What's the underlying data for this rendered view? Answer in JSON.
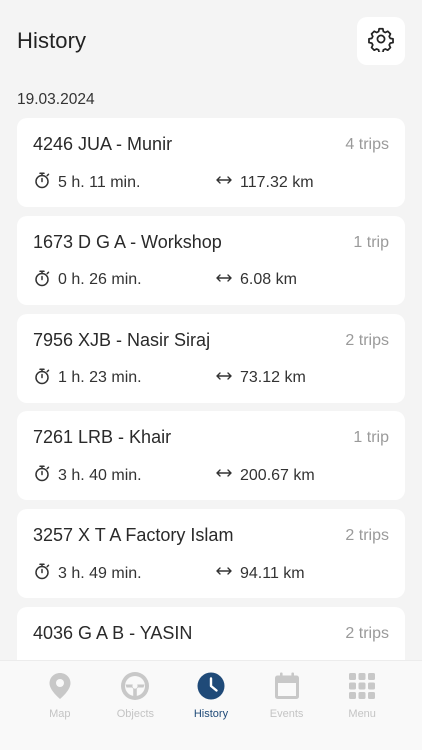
{
  "header": {
    "title": "History"
  },
  "date": "19.03.2024",
  "trips": [
    {
      "name": "4246 JUA - Munir",
      "trips": "4 trips",
      "duration": "5 h. 11 min.",
      "distance": "117.32 km"
    },
    {
      "name": "1673 D G A - Workshop",
      "trips": "1 trip",
      "duration": "0 h. 26 min.",
      "distance": "6.08 km"
    },
    {
      "name": "7956 XJB - Nasir Siraj",
      "trips": "2 trips",
      "duration": "1 h. 23 min.",
      "distance": "73.12 km"
    },
    {
      "name": "7261 LRB - Khair",
      "trips": "1 trip",
      "duration": "3 h. 40 min.",
      "distance": "200.67 km"
    },
    {
      "name": "3257 X T A Factory Islam",
      "trips": "2 trips",
      "duration": "3 h. 49 min.",
      "distance": "94.11 km"
    },
    {
      "name": "4036 G A B - YASIN",
      "trips": "2 trips",
      "duration": "",
      "distance": ""
    }
  ],
  "nav": [
    {
      "label": "Map",
      "icon": "map-pin-icon"
    },
    {
      "label": "Objects",
      "icon": "steering-wheel-icon"
    },
    {
      "label": "History",
      "icon": "clock-icon",
      "active": true
    },
    {
      "label": "Events",
      "icon": "calendar-icon"
    },
    {
      "label": "Menu",
      "icon": "grid-icon"
    }
  ],
  "colors": {
    "accent": "#1f4a78",
    "inactive": "#c4c4c4",
    "background": "#f4f4f4",
    "card": "#ffffff"
  }
}
